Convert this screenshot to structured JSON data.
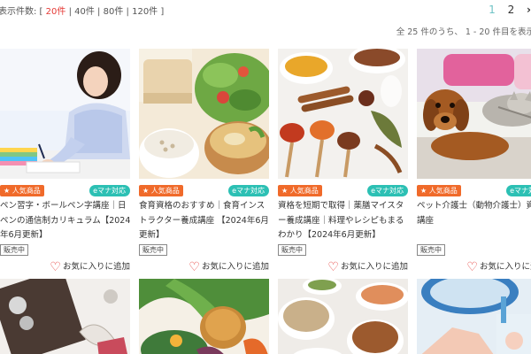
{
  "toolbar": {
    "per_page_label": "表示件数: [",
    "per_page_options": [
      "20件",
      "40件",
      "80件",
      "120件"
    ],
    "per_page_close": "]",
    "pages": [
      "1",
      "2"
    ],
    "next_icon": "chevron-right-icon",
    "next_glyph": "›",
    "total_text": "全 25 件のうち、 1 - 20 件目を表示"
  },
  "cards": [
    {
      "popular": "★ 人気商品",
      "emana": "eマナ対応",
      "title": "ペン習字・ボールペン字講座｜日ペンの通信制カリキュラム【2024年6月更新】",
      "status": "販売中",
      "fav": "お気に入りに追加"
    },
    {
      "popular": "★ 人気商品",
      "emana": "eマナ対応",
      "title": "食育資格のおすすめ｜食育インストラクター養成講座 【2024年6月更新】",
      "status": "販売中",
      "fav": "お気に入りに追加"
    },
    {
      "popular": "★ 人気商品",
      "emana": "eマナ対応",
      "title": "資格を短期で取得｜薬膳マイスター養成講座｜料理やレシピもまるわかり【2024年6月更新】",
      "status": "販売中",
      "fav": "お気に入りに追加"
    },
    {
      "popular": "★ 人気商品",
      "emana": "eマナ対応",
      "title": "ペット介護士（動物介護士）資格講座",
      "status": "販売中",
      "fav": "お気に入りに追加"
    }
  ]
}
